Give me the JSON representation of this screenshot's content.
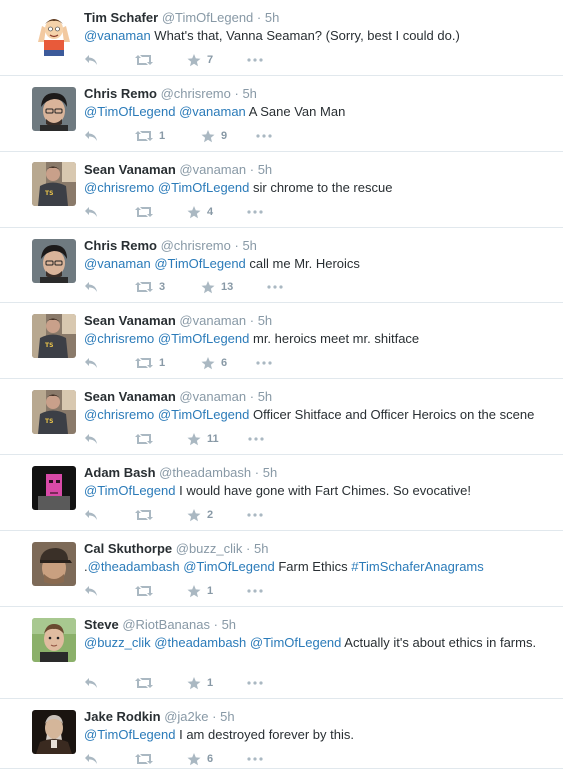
{
  "tweets": [
    {
      "name": "Tim Schafer",
      "handle": "@TimOfLegend",
      "sep": "·",
      "time": "5h",
      "avatar": "cartoon",
      "segments": [
        {
          "t": "mention",
          "v": "@vanaman"
        },
        {
          "t": "text",
          "v": " What's that, Vanna Seaman? (Sorry, best I could do.)"
        }
      ],
      "retweets": "",
      "favorites": "7"
    },
    {
      "name": "Chris Remo",
      "handle": "@chrisremo",
      "sep": "·",
      "time": "5h",
      "avatar": "dark-hair",
      "segments": [
        {
          "t": "mention",
          "v": "@TimOfLegend"
        },
        {
          "t": "text",
          "v": " "
        },
        {
          "t": "mention",
          "v": "@vanaman"
        },
        {
          "t": "text",
          "v": " A Sane Van Man"
        }
      ],
      "retweets": "1",
      "favorites": "9"
    },
    {
      "name": "Sean Vanaman",
      "handle": "@vanaman",
      "sep": "·",
      "time": "5h",
      "avatar": "tshirt",
      "segments": [
        {
          "t": "mention",
          "v": "@chrisremo"
        },
        {
          "t": "text",
          "v": " "
        },
        {
          "t": "mention",
          "v": "@TimOfLegend"
        },
        {
          "t": "text",
          "v": " sir chrome to the rescue"
        }
      ],
      "retweets": "",
      "favorites": "4"
    },
    {
      "name": "Chris Remo",
      "handle": "@chrisremo",
      "sep": "·",
      "time": "5h",
      "avatar": "dark-hair",
      "segments": [
        {
          "t": "mention",
          "v": "@vanaman"
        },
        {
          "t": "text",
          "v": " "
        },
        {
          "t": "mention",
          "v": "@TimOfLegend"
        },
        {
          "t": "text",
          "v": " call me Mr. Heroics"
        }
      ],
      "retweets": "3",
      "favorites": "13"
    },
    {
      "name": "Sean Vanaman",
      "handle": "@vanaman",
      "sep": "·",
      "time": "5h",
      "avatar": "tshirt",
      "segments": [
        {
          "t": "mention",
          "v": "@chrisremo"
        },
        {
          "t": "text",
          "v": " "
        },
        {
          "t": "mention",
          "v": "@TimOfLegend"
        },
        {
          "t": "text",
          "v": " mr. heroics meet mr. shitface"
        }
      ],
      "retweets": "1",
      "favorites": "6"
    },
    {
      "name": "Sean Vanaman",
      "handle": "@vanaman",
      "sep": "·",
      "time": "5h",
      "avatar": "tshirt",
      "segments": [
        {
          "t": "mention",
          "v": "@chrisremo"
        },
        {
          "t": "text",
          "v": " "
        },
        {
          "t": "mention",
          "v": "@TimOfLegend"
        },
        {
          "t": "text",
          "v": " Officer Shitface and Officer Heroics on the scene"
        }
      ],
      "retweets": "",
      "favorites": "11"
    },
    {
      "name": "Adam Bash",
      "handle": "@theadambash",
      "sep": "·",
      "time": "5h",
      "avatar": "pink",
      "segments": [
        {
          "t": "mention",
          "v": "@TimOfLegend"
        },
        {
          "t": "text",
          "v": " I would have gone with Fart Chimes. So evocative!"
        }
      ],
      "retweets": "",
      "favorites": "2"
    },
    {
      "name": "Cal Skuthorpe",
      "handle": "@buzz_clik",
      "sep": "·",
      "time": "5h",
      "avatar": "cap",
      "segments": [
        {
          "t": "text",
          "v": "."
        },
        {
          "t": "mention",
          "v": "@theadambash"
        },
        {
          "t": "text",
          "v": " "
        },
        {
          "t": "mention",
          "v": "@TimOfLegend"
        },
        {
          "t": "text",
          "v": " Farm Ethics "
        },
        {
          "t": "hashtag",
          "v": "#TimSchaferAnagrams"
        }
      ],
      "retweets": "",
      "favorites": "1"
    },
    {
      "name": "Steve",
      "handle": "@RiotBananas",
      "sep": "·",
      "time": "5h",
      "avatar": "outdoor",
      "segments": [
        {
          "t": "mention",
          "v": "@buzz_clik"
        },
        {
          "t": "text",
          "v": " "
        },
        {
          "t": "mention",
          "v": "@theadambash"
        },
        {
          "t": "text",
          "v": " "
        },
        {
          "t": "mention",
          "v": "@TimOfLegend"
        },
        {
          "t": "text",
          "v": " Actually it's about ethics in farms."
        }
      ],
      "retweets": "",
      "favorites": "1"
    },
    {
      "name": "Jake Rodkin",
      "handle": "@ja2ke",
      "sep": "·",
      "time": "5h",
      "avatar": "portrait",
      "segments": [
        {
          "t": "mention",
          "v": "@TimOfLegend"
        },
        {
          "t": "text",
          "v": " I am destroyed forever by this."
        }
      ],
      "retweets": "",
      "favorites": "6"
    }
  ],
  "icons": {
    "reply": "reply-icon",
    "retweet": "retweet-icon",
    "favorite": "star-icon",
    "more": "more-icon"
  },
  "colors": {
    "link": "#2b7bb9",
    "meta": "#8899a6",
    "icon": "#aab8c2",
    "divider": "#e1e8ed"
  }
}
